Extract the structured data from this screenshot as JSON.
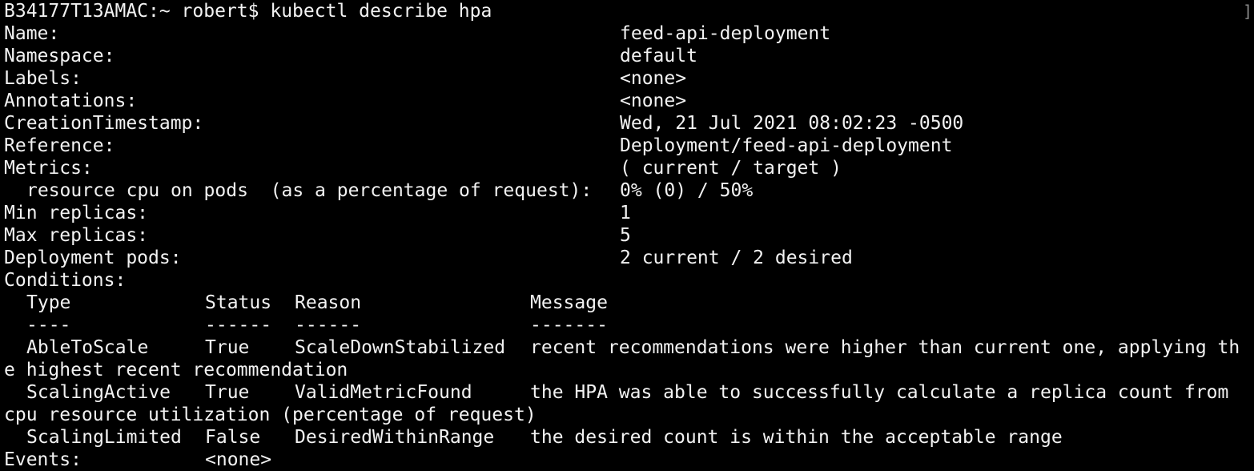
{
  "prompt": {
    "host": "B34177T13AMAC:~ robert$",
    "command": "kubectl describe hpa",
    "scroll_marker": "]"
  },
  "fields": [
    {
      "key": "Name:",
      "value": "feed-api-deployment"
    },
    {
      "key": "Namespace:",
      "value": "default"
    },
    {
      "key": "Labels:",
      "value": "<none>"
    },
    {
      "key": "Annotations:",
      "value": "<none>"
    },
    {
      "key": "CreationTimestamp:",
      "value": "Wed, 21 Jul 2021 08:02:23 -0500"
    },
    {
      "key": "Reference:",
      "value": "Deployment/feed-api-deployment"
    },
    {
      "key": "Metrics:",
      "value": "( current / target )"
    }
  ],
  "metric": {
    "key": "resource cpu on pods  (as a percentage of request):",
    "value": "0% (0) / 50%"
  },
  "fields2": [
    {
      "key": "Min replicas:",
      "value": "1"
    },
    {
      "key": "Max replicas:",
      "value": "5"
    },
    {
      "key": "Deployment pods:",
      "value": "2 current / 2 desired"
    }
  ],
  "conditions": {
    "label": "Conditions:",
    "headers": {
      "type": "Type",
      "status": "Status",
      "reason": "Reason",
      "message": "Message"
    },
    "underlines": {
      "type": "----",
      "status": "------",
      "reason": "------",
      "message": "-------"
    },
    "rows": [
      {
        "type": "AbleToScale",
        "status": "True",
        "reason": "ScaleDownStabilized",
        "message": "recent recommendations were higher than current one, applying th",
        "wrap": "e highest recent recommendation"
      },
      {
        "type": "ScalingActive",
        "status": "True",
        "reason": "ValidMetricFound",
        "message": "the HPA was able to successfully calculate a replica count from",
        "wrap": "cpu resource utilization (percentage of request)"
      },
      {
        "type": "ScalingLimited",
        "status": "False",
        "reason": "DesiredWithinRange",
        "message": "the desired count is within the acceptable range",
        "wrap": ""
      }
    ]
  },
  "events": {
    "key": "Events:",
    "value": "<none>"
  }
}
